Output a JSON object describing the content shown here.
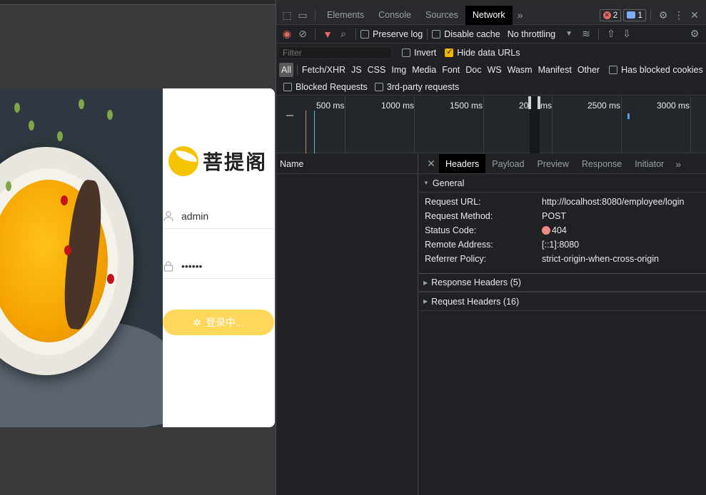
{
  "login": {
    "brand": "菩提阁",
    "username": "admin",
    "password_mask": "••••••",
    "button_label": "登录中..."
  },
  "devtools": {
    "main_tabs": [
      "Elements",
      "Console",
      "Sources",
      "Network"
    ],
    "active_main_tab": "Network",
    "errors_count": "2",
    "messages_count": "1",
    "toolbar": {
      "preserve_log": "Preserve log",
      "disable_cache": "Disable cache",
      "throttling": "No throttling"
    },
    "filter": {
      "placeholder": "Filter",
      "invert": "Invert",
      "hide_data_urls": "Hide data URLs",
      "hide_data_urls_checked": true,
      "types": [
        "All",
        "Fetch/XHR",
        "JS",
        "CSS",
        "Img",
        "Media",
        "Font",
        "Doc",
        "WS",
        "Wasm",
        "Manifest",
        "Other"
      ],
      "has_blocked_cookies": "Has blocked cookies",
      "blocked_requests": "Blocked Requests",
      "third_party": "3rd-party requests"
    },
    "timeline_ticks": [
      "500 ms",
      "1000 ms",
      "1500 ms",
      "2000 ms",
      "2500 ms",
      "3000 ms"
    ],
    "name_header": "Name",
    "detail_tabs": [
      "Headers",
      "Payload",
      "Preview",
      "Response",
      "Initiator"
    ],
    "active_detail_tab": "Headers",
    "general": {
      "title": "General",
      "rows": [
        {
          "key": "Request URL:",
          "value": "http://localhost:8080/employee/login"
        },
        {
          "key": "Request Method:",
          "value": "POST"
        },
        {
          "key": "Status Code:",
          "value": "404"
        },
        {
          "key": "Remote Address:",
          "value": "[::1]:8080"
        },
        {
          "key": "Referrer Policy:",
          "value": "strict-origin-when-cross-origin"
        }
      ]
    },
    "response_headers": "Response Headers (5)",
    "request_headers": "Request Headers (16)",
    "colors": {
      "status_error": "#ee8a80",
      "accent_checkbox": "#f0b400",
      "login_button": "#ffd75a"
    }
  }
}
